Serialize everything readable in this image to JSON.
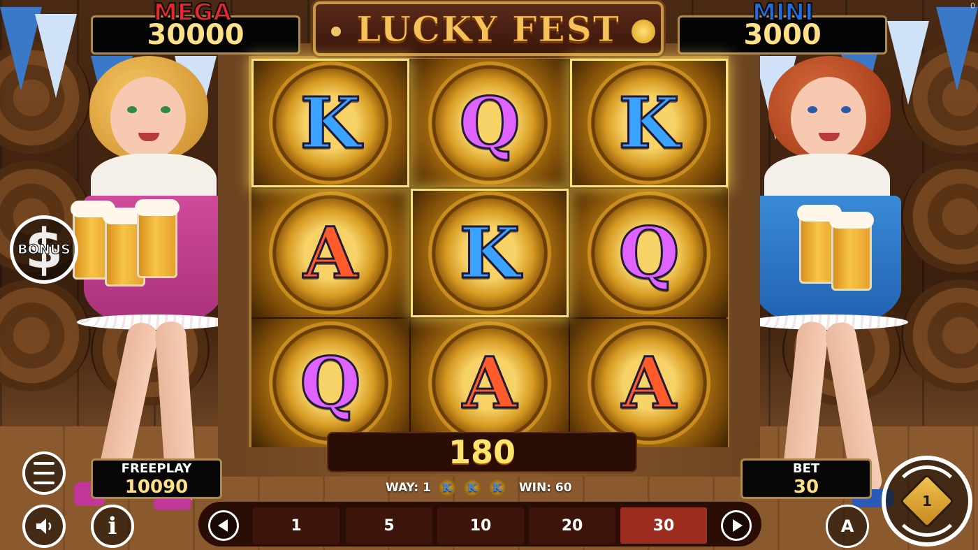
{
  "game": {
    "title": "LUCKY FEST",
    "corner_text": "0"
  },
  "jackpots": {
    "mega": {
      "label": "MEGA",
      "value": "30000",
      "color": "#e8282a"
    },
    "mini": {
      "label": "MINI",
      "value": "3000",
      "color": "#1f6fe0"
    }
  },
  "reels": {
    "columns": 3,
    "rows": 3,
    "symbols": [
      [
        "K",
        "Q",
        "K"
      ],
      [
        "A",
        "K",
        "Q"
      ],
      [
        "Q",
        "A",
        "A"
      ]
    ],
    "highlighted": [
      [
        0,
        0
      ],
      [
        0,
        2
      ],
      [
        1,
        1
      ]
    ]
  },
  "win_display": {
    "amount": "180"
  },
  "way_info": {
    "way_label": "WAY: 1",
    "symbols": [
      "K",
      "K",
      "K"
    ],
    "win_label": "WIN: 60"
  },
  "freeplay": {
    "label": "FREEPLAY",
    "value": "10090"
  },
  "bet": {
    "label": "BET",
    "value": "30"
  },
  "bet_options": [
    "1",
    "5",
    "10",
    "20",
    "30"
  ],
  "bet_selected": "30",
  "buttons": {
    "bonus": {
      "label": "BONUS",
      "icon": "dollar-icon"
    },
    "menu": {
      "icon": "menu-icon"
    },
    "sound": {
      "icon": "speaker-icon"
    },
    "info": {
      "icon": "info-icon",
      "glyph": "i"
    },
    "autoplay": {
      "icon": "autoplay-icon",
      "glyph": "A"
    },
    "prev": {
      "icon": "chevron-left-icon"
    },
    "next": {
      "icon": "chevron-right-icon"
    },
    "spin": {
      "icon": "spin-icon",
      "glyph": "1"
    }
  },
  "colors": {
    "symbol_K": "#3aa3ff",
    "symbol_Q": "#e163ff",
    "symbol_A": "#ff5a2a",
    "value_gold": "#ffe08a",
    "active_bet": "#9c2d1e"
  }
}
